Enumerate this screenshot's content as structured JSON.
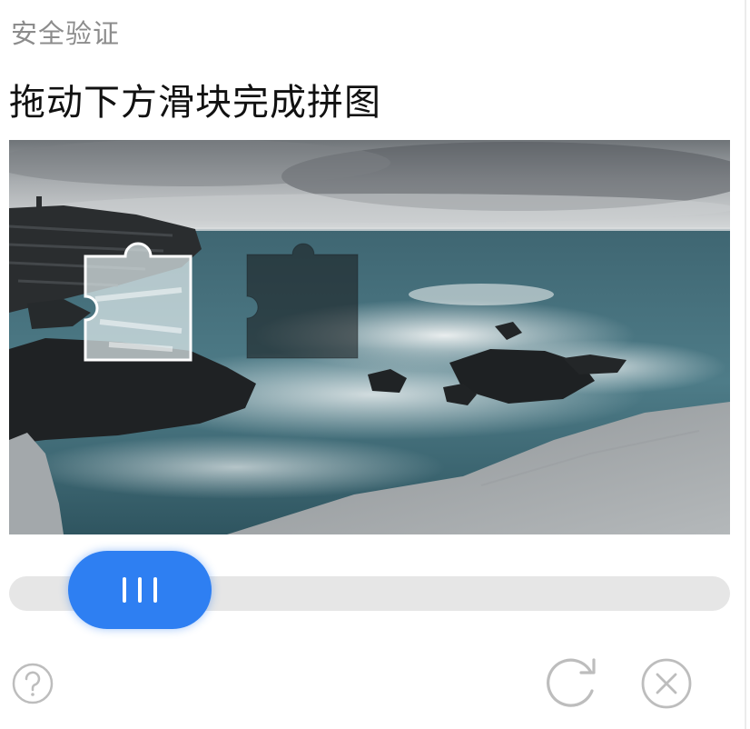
{
  "header": {
    "title": "安全验证"
  },
  "instruction": {
    "text": "拖动下方滑块完成拼图"
  },
  "slider": {
    "progress": 0.08
  },
  "actions": {
    "help_icon": "question-circle-icon",
    "refresh_icon": "refresh-icon",
    "close_icon": "close-circle-icon"
  },
  "colors": {
    "accent": "#2e7ff2",
    "track": "#e6e6e6",
    "icon": "#bdbdbd"
  }
}
